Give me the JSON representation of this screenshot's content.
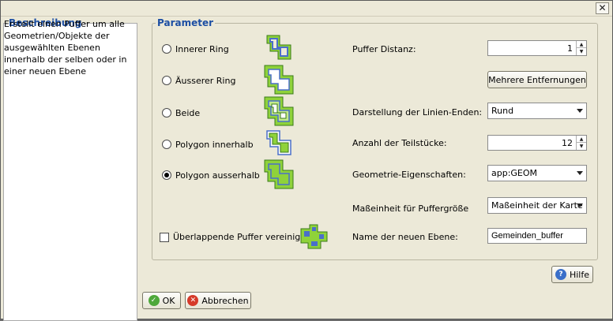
{
  "window": {
    "close_glyph": "✕"
  },
  "description": {
    "legend": "Beschreibung",
    "text": "Erstellt einen Puffer um alle Geometrien/Objekte der ausgewählten Ebenen innerhalb der selben oder in einer neuen Ebene"
  },
  "parameters": {
    "legend": "Parameter",
    "modes": [
      {
        "label": "Innerer Ring",
        "checked": false,
        "icon": "inner-ring-icon"
      },
      {
        "label": "Äusserer Ring",
        "checked": false,
        "icon": "outer-ring-icon"
      },
      {
        "label": "Beide",
        "checked": false,
        "icon": "both-rings-icon"
      },
      {
        "label": "Polygon innerhalb",
        "checked": false,
        "icon": "polygon-inside-icon"
      },
      {
        "label": "Polygon ausserhalb",
        "checked": true,
        "icon": "polygon-outside-icon"
      }
    ],
    "merge_label": "Überlappende Puffer vereinigen",
    "buffer_distance": {
      "label": "Puffer Distanz:",
      "value": "1"
    },
    "multi_distance_button": "Mehrere Entfernungen",
    "line_ends": {
      "label": "Darstellung der Linien-Enden:",
      "value": "Rund"
    },
    "segments": {
      "label": "Anzahl der Teilstücke:",
      "value": "12"
    },
    "geometry": {
      "label": "Geometrie-Eigenschaften:",
      "value": "app:GEOM"
    },
    "unit": {
      "label": "Maßeinheit für Puffergröße",
      "value": "Maßeinheit der Karte"
    },
    "layer_name": {
      "label": "Name der neuen Ebene:",
      "value": "Gemeinden_buffer"
    }
  },
  "buttons": {
    "help": "Hilfe",
    "ok": "OK",
    "cancel": "Abbrechen"
  },
  "colors": {
    "legend": "#1c4ea3",
    "green": "#8fd23a",
    "blue": "#4a6fc9",
    "ok_icon": "#4ea83a",
    "cancel_icon": "#d63a2a",
    "help_icon": "#3a6fc9"
  }
}
